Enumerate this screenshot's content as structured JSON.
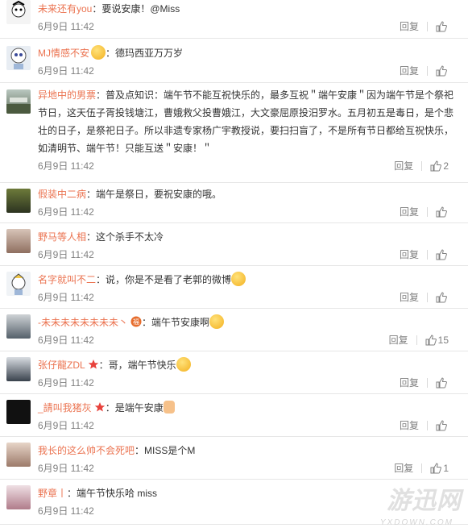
{
  "comments": [
    {
      "user": "未来还有you",
      "text": "：要说安康！@Miss",
      "date": "6月9日 11:42",
      "reply": "回复",
      "likes": ""
    },
    {
      "user": "MJ情感不安",
      "text": "：德玛西亚万万岁",
      "date": "6月9日 11:42",
      "reply": "回复",
      "likes": ""
    },
    {
      "user": "异地中的男票",
      "text": "：普及点知识：端午节不能互祝快乐的，最多互祝＂端午安康＂因为端午节是个祭祀节日，这天伍子胥投钱塘江，曹娥救父投曹娥江，大文豪屈原投汨罗水。五月初五是毒日，是个悲壮的日子，是祭祀日子。所以非遗专家杨广宇教授说，要扫扫盲了，不是所有节日都给互祝快乐，如清明节、端午节！只能互送＂安康！＂",
      "date": "6月9日 11:42",
      "reply": "回复",
      "likes": "2"
    },
    {
      "user": "假装中二病",
      "text": "：端午是祭日，要祝安康的哦。",
      "date": "6月9日 11:42",
      "reply": "回复",
      "likes": ""
    },
    {
      "user": "野马等人相",
      "text": "：这个杀手不太冷",
      "date": "6月9日 11:42",
      "reply": "回复",
      "likes": ""
    },
    {
      "user": "名字就叫不二",
      "text": "：说，你是不是看了老郭的微博",
      "date": "6月9日 11:42",
      "reply": "回复",
      "likes": ""
    },
    {
      "user": "-未未未未未未未未丶",
      "text": "：端午节安康啊",
      "date": "6月9日 11:42",
      "reply": "回复",
      "likes": "15"
    },
    {
      "user": "张仔龍ZDL",
      "text": "：哥，端午节快乐",
      "date": "6月9日 11:42",
      "reply": "回复",
      "likes": ""
    },
    {
      "user": "_請叫我猪灰",
      "text": "：是端午安康",
      "date": "6月9日 11:42",
      "reply": "回复",
      "likes": ""
    },
    {
      "user": "我长的这么帅不会死吧",
      "text": "：MISS是个M",
      "date": "6月9日 11:42",
      "reply": "回复",
      "likes": "1"
    },
    {
      "user": "野章丨",
      "text": "：端午节快乐哈 miss",
      "date": "6月9日 11:42",
      "reply": "回复",
      "likes": ""
    }
  ],
  "watermark": {
    "main": "游迅网",
    "sub": "YXDOWN.COM"
  },
  "colors": {
    "username": "#eb7350",
    "meta": "#808080",
    "divider": "#e6e6e6"
  }
}
